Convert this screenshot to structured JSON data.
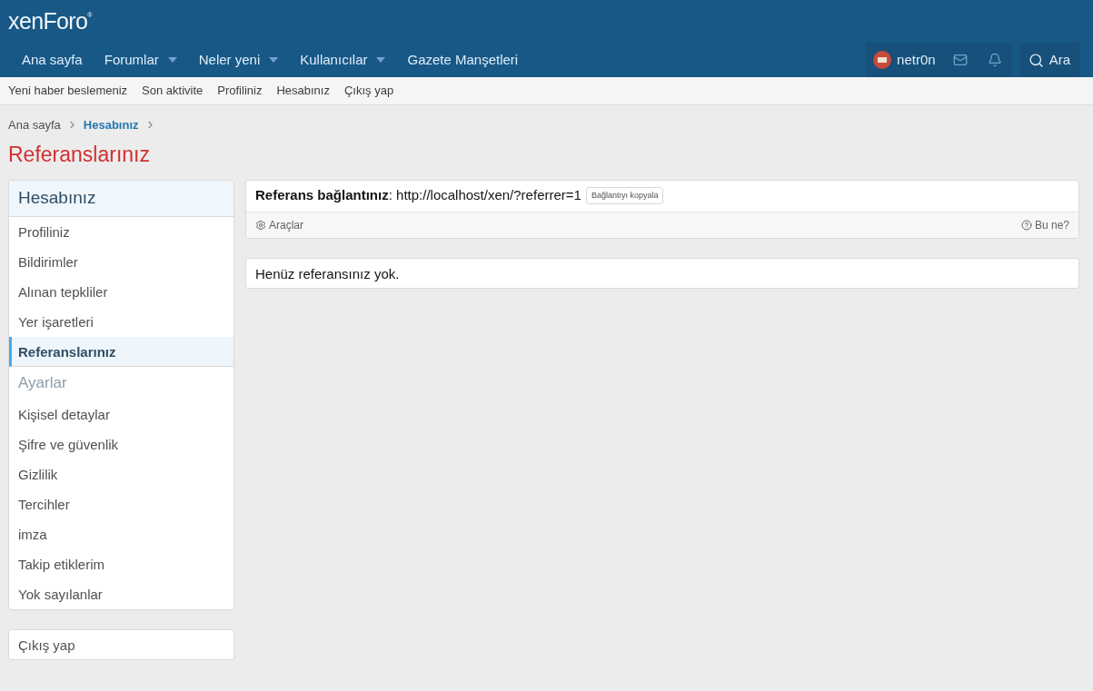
{
  "logo": {
    "text": "xenForo",
    "mark": "®"
  },
  "nav": [
    {
      "label": "Ana sayfa",
      "has_menu": false,
      "selected": false
    },
    {
      "label": "Forumlar",
      "has_menu": true,
      "selected": false
    },
    {
      "label": "Neler yeni",
      "has_menu": true,
      "selected": false
    },
    {
      "label": "Kullanıcılar",
      "has_menu": true,
      "selected": false
    },
    {
      "label": "Gazete Manşetleri",
      "has_menu": false,
      "selected": false
    }
  ],
  "user": {
    "name": "netr0n"
  },
  "search": {
    "label": "Ara"
  },
  "subnav": [
    "Yeni haber beslemeniz",
    "Son aktivite",
    "Profiliniz",
    "Hesabınız",
    "Çıkış yap"
  ],
  "breadcrumb": [
    {
      "label": "Ana sayfa",
      "current": false
    },
    {
      "label": "Hesabınız",
      "current": true
    }
  ],
  "page_title": "Referanslarınız",
  "sidebar": {
    "sections": [
      {
        "heading": "Hesabınız",
        "items": [
          {
            "label": "Profiliniz",
            "selected": false
          },
          {
            "label": "Bildirimler",
            "selected": false
          },
          {
            "label": "Alınan tepkliler",
            "selected": false
          },
          {
            "label": "Yer işaretleri",
            "selected": false
          },
          {
            "label": "Referanslarınız",
            "selected": true
          }
        ]
      },
      {
        "heading": "Ayarlar",
        "items": [
          {
            "label": "Kişisel detaylar",
            "selected": false
          },
          {
            "label": "Şifre ve güvenlik",
            "selected": false
          },
          {
            "label": "Gizlilik",
            "selected": false
          },
          {
            "label": "Tercihler",
            "selected": false
          },
          {
            "label": "imza",
            "selected": false
          },
          {
            "label": "Takip etiklerim",
            "selected": false
          },
          {
            "label": "Yok sayılanlar",
            "selected": false
          }
        ]
      }
    ],
    "logout": "Çıkış yap"
  },
  "referral": {
    "text": "**Referans bağlantınız**: http://localhost/xen/?referrer=1",
    "copy_button": "Bağlantıyı kopyala",
    "tools": "Araçlar",
    "help": "Bu ne?"
  },
  "empty_message": "Henüz referansınız yok."
}
